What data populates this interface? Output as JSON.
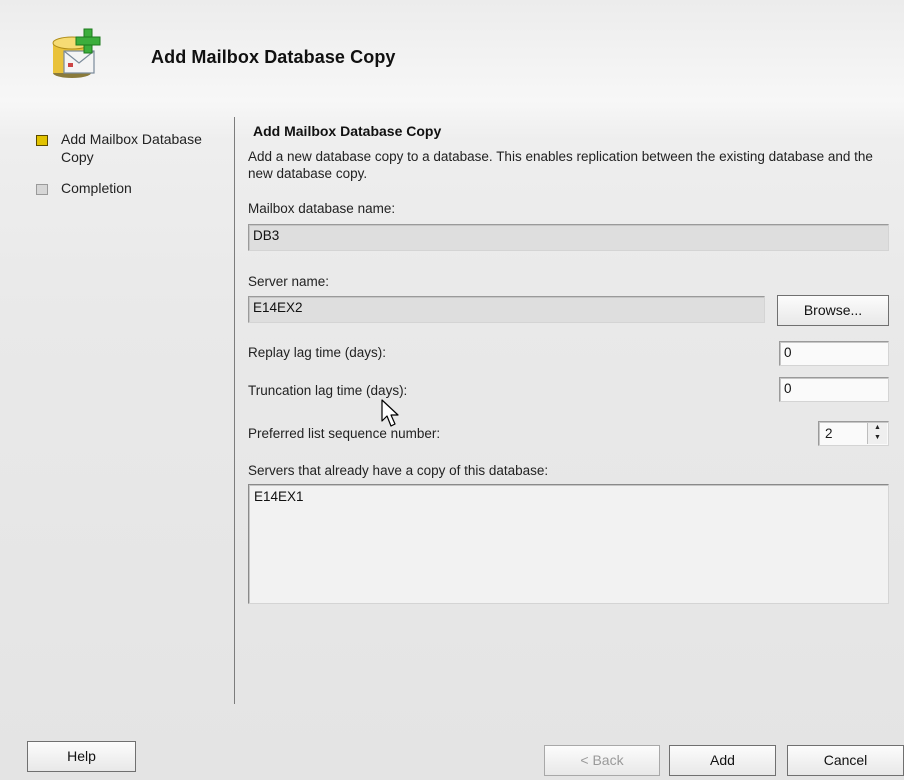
{
  "header": {
    "title": "Add Mailbox Database Copy",
    "icon": "mailbox-database-add-icon"
  },
  "nav": {
    "steps": [
      {
        "label": "Add Mailbox Database Copy",
        "state": "active"
      },
      {
        "label": "Completion",
        "state": "pending"
      }
    ]
  },
  "content": {
    "title": "Add Mailbox Database Copy",
    "description": "Add a new database copy to a database. This enables replication between the existing database and the new database copy.",
    "db_name": {
      "label": "Mailbox database name:",
      "value": "DB3"
    },
    "server_name": {
      "label": "Server name:",
      "value": "E14EX2",
      "browse_label": "Browse..."
    },
    "replay_lag": {
      "label": "Replay lag time (days):",
      "value": "0"
    },
    "truncation_lag": {
      "label": "Truncation lag time (days):",
      "value": "0"
    },
    "sequence": {
      "label": "Preferred list sequence number:",
      "value": "2"
    },
    "servers": {
      "label": "Servers that already have a copy of this database:",
      "items": [
        "E14EX1"
      ]
    }
  },
  "footer": {
    "help": "Help",
    "back": "< Back",
    "add": "Add",
    "cancel": "Cancel"
  },
  "colors": {
    "active_step": "#e1c200",
    "pending_step": "#d6d6d6",
    "readonly_field": "#dedede"
  }
}
